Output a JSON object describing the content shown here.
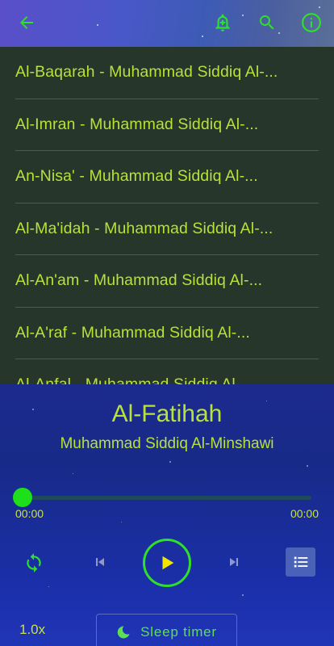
{
  "icons": {
    "back": "arrow-left-icon",
    "alarm": "alarm-add-icon",
    "search": "search-icon",
    "info": "info-icon",
    "repeat": "repeat-icon",
    "previous": "skip-previous-icon",
    "play": "play-icon",
    "next": "skip-next-icon",
    "playlist": "playlist-icon",
    "moon": "moon-icon"
  },
  "colors": {
    "accent": "#b8e23a",
    "green": "#2fe02a",
    "list_bg": "#27362b",
    "player_bg": "#1a2c96"
  },
  "tracks": [
    "Al-Baqarah - Muhammad Siddiq Al-...",
    "Al-Imran - Muhammad Siddiq Al-...",
    "An-Nisa' - Muhammad Siddiq Al-...",
    "Al-Ma'idah - Muhammad Siddiq Al-...",
    "Al-An'am - Muhammad Siddiq Al-...",
    "Al-A'raf - Muhammad Siddiq Al-...",
    "Al-Anfal - Muhammad Siddiq Al-..."
  ],
  "player": {
    "title": "Al-Fatihah",
    "artist": "Muhammad Siddiq Al-Minshawi",
    "elapsed": "00:00",
    "duration": "00:00",
    "progress": 0.0,
    "speed": "1.0x",
    "sleep_timer_label": "Sleep timer"
  }
}
